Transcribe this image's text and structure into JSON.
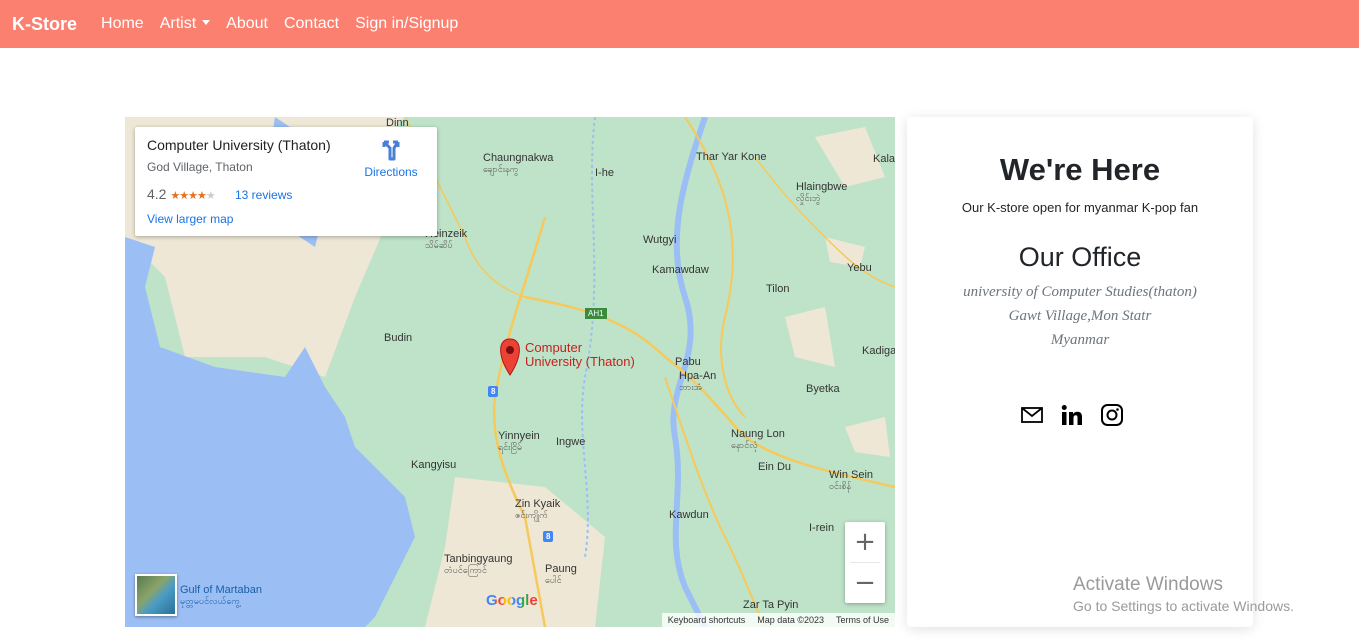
{
  "navbar": {
    "brand": "K-Store",
    "links": [
      "Home",
      "Artist",
      "About",
      "Contact",
      "Sign in/Signup"
    ],
    "bg_color": "#fc8070"
  },
  "map": {
    "info_card": {
      "title": "Computer University (Thaton)",
      "address": "God Village, Thaton",
      "rating": "4.2",
      "stars": "★★★★",
      "star_off": "★",
      "reviews": "13 reviews",
      "larger_map": "View larger map",
      "directions": "Directions"
    },
    "pin_label_1": "Computer",
    "pin_label_2": "University (Thaton)",
    "places": {
      "chaungnakwa": "Chaungnakwa",
      "chaungnakwa_my": "ချောင်းနကွ",
      "ihe": "I-he",
      "thar_yar_kone": "Thar Yar Kone",
      "kala": "Kala",
      "hlaingbwe": "Hlaingbwe",
      "hlaingbwe_my": "လှိုင်းဘွဲ",
      "heinzeik": "Heinzeik",
      "heinzeik_my": "သိမ်ဆိပ်",
      "wutgyi": "Wutgyi",
      "kamawdaw": "Kamawdaw",
      "yebu": "Yebu",
      "tilon": "Tilon",
      "budin": "Budin",
      "pabu": "Pabu",
      "hpa_an": "Hpa-An",
      "hpa_an_my": "ဘားအံ",
      "kadiga": "Kadiga",
      "byetka": "Byetka",
      "yinnyein": "Yinnyein",
      "yinnyein_my": "ရင်းငြိမ်",
      "ingwe": "Ingwe",
      "naung_lon": "Naung Lon",
      "naung_lon_my": "နောင်လုံ",
      "ein_du": "Ein Du",
      "kangyisu": "Kangyisu",
      "win_sein": "Win Sein",
      "win_sein_my": "ဝင်းစိန်",
      "zin_kyaik": "Zin Kyaik",
      "zin_kyaik_my": "ဇင်းကျိုက်",
      "kawdun": "Kawdun",
      "irein": "I-rein",
      "tanbingyaung": "Tanbingyaung",
      "tanbingyaung_my": "တံပင်ကြောင်",
      "paung": "Paung",
      "paung_my": "ပေါင်",
      "zar_ta_pyin": "Zar Ta Pyin",
      "dinn": "Dinn"
    },
    "gulf": "Gulf of Martaban",
    "gulf_my": "မုတ္တမပင်လယ်ကွေ့",
    "route_ah1": "AH1",
    "route_8a": "8",
    "route_8b": "8",
    "google": "Google",
    "footer": [
      "Keyboard shortcuts",
      "Map data ©2023",
      "Terms of Use"
    ],
    "zoom_in": "+",
    "zoom_out": "−"
  },
  "office": {
    "here_title": "We're Here",
    "here_sub": "Our K-store open for myanmar K-pop fan",
    "office_title": "Our Office",
    "address_lines": [
      "university of Computer Studies(thaton)",
      "Gawt Village,Mon Statr",
      "Myanmar"
    ],
    "socials": [
      "mail-icon",
      "linkedin-icon",
      "instagram-icon"
    ]
  },
  "watermark": {
    "line1": "Activate Windows",
    "line2": "Go to Settings to activate Windows."
  }
}
